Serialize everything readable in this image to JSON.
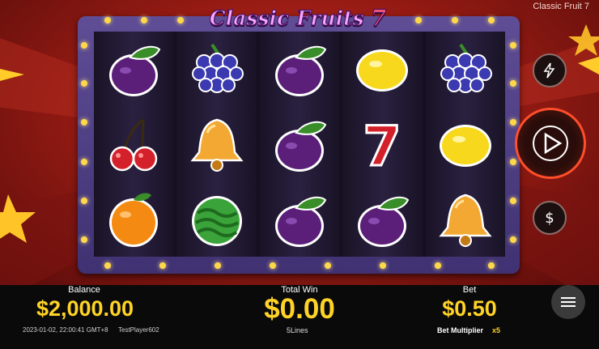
{
  "game": {
    "title": "Classic Fruit 7"
  },
  "logo": {
    "main": "Classic Fruits",
    "seven": "7"
  },
  "reels": [
    [
      "plum",
      "cherry",
      "orange"
    ],
    [
      "grapes",
      "bell",
      "watermelon"
    ],
    [
      "plum",
      "plum",
      "plum"
    ],
    [
      "lemon",
      "seven",
      "plum"
    ],
    [
      "grapes",
      "lemon",
      "bell"
    ]
  ],
  "footer": {
    "balance_label": "Balance",
    "balance_value": "$2,000.00",
    "win_label": "Total Win",
    "win_value": "$0.00",
    "bet_label": "Bet",
    "bet_value": "$0.50",
    "timestamp": "2023-01-02, 22:00:41 GMT+8",
    "player": "TestPlayer602",
    "lines": "5Lines",
    "multiplier_label": "Bet Multiplier",
    "multiplier_value": "x5"
  },
  "colors": {
    "gold": "#ffd326",
    "accent": "#ff4e2a"
  }
}
